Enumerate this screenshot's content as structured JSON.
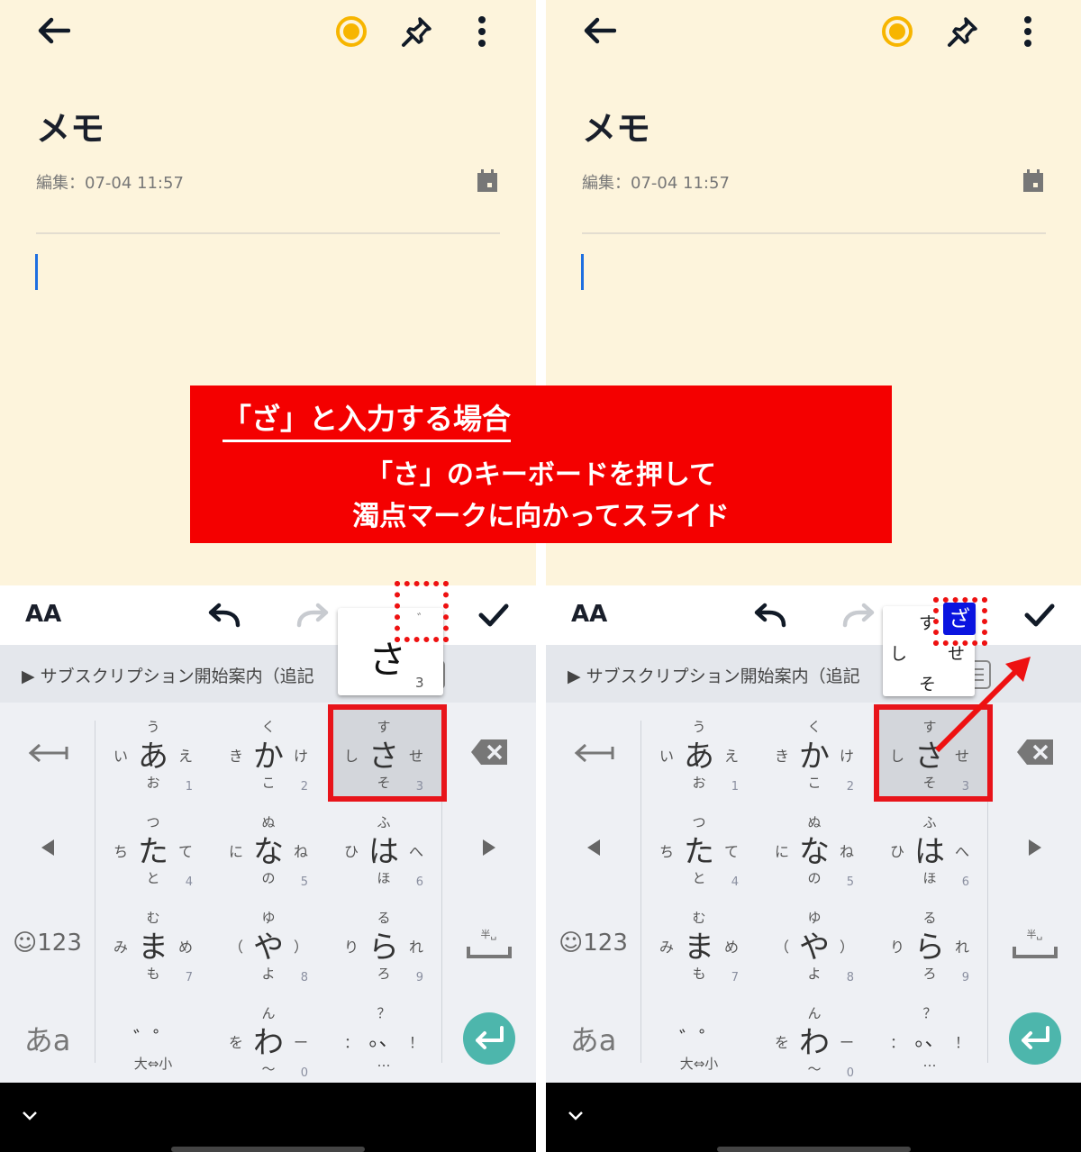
{
  "note": {
    "title": "メモ",
    "edited": "編集：07-04 11:57"
  },
  "toolbar": {
    "text_style": "AA"
  },
  "suggestion": {
    "text": "▶ サブスクリプション開始案内（追記"
  },
  "keyboard": {
    "keys": [
      {
        "m": "あ",
        "l": "い",
        "t": "う",
        "r": "え",
        "b": "お",
        "n": "1"
      },
      {
        "m": "か",
        "l": "き",
        "t": "く",
        "r": "け",
        "b": "こ",
        "n": "2"
      },
      {
        "m": "さ",
        "l": "し",
        "t": "す",
        "r": "せ",
        "b": "そ",
        "n": "3"
      },
      {
        "m": "た",
        "l": "ち",
        "t": "つ",
        "r": "て",
        "b": "と",
        "n": "4"
      },
      {
        "m": "な",
        "l": "に",
        "t": "ぬ",
        "r": "ね",
        "b": "の",
        "n": "5"
      },
      {
        "m": "は",
        "l": "ひ",
        "t": "ふ",
        "r": "へ",
        "b": "ほ",
        "n": "6"
      },
      {
        "m": "ま",
        "l": "み",
        "t": "む",
        "r": "め",
        "b": "も",
        "n": "7"
      },
      {
        "m": "や",
        "l": "（",
        "t": "ゆ",
        "r": "）",
        "b": "よ",
        "n": "8"
      },
      {
        "m": "ら",
        "l": "り",
        "t": "る",
        "r": "れ",
        "b": "ろ",
        "n": "9"
      },
      {
        "m": "゛゜",
        "l": "",
        "t": "",
        "r": "",
        "b": "大⇔小",
        "n": ""
      },
      {
        "m": "わ",
        "l": "を",
        "t": "ん",
        "r": "ー",
        "b": "〜",
        "n": "0"
      },
      {
        "m": "。、",
        "l": "：",
        "t": "？",
        "r": "！",
        "b": "…",
        "n": ""
      }
    ],
    "emoji_num": "☺123",
    "kana_mode": "あa",
    "space_label": "半␣",
    "accent": "#4db6ac"
  },
  "popups": {
    "left": {
      "main": "さ",
      "dakuten": "゛",
      "num": "3"
    },
    "right": {
      "top": "す",
      "selected": "ざ",
      "left": "し",
      "right": "せ",
      "bottom": "そ",
      "selected_color": "#0a14e0"
    }
  },
  "banner": {
    "heading": "「ざ」と入力する場合",
    "line1": "「さ」のキーボードを押して",
    "line2": "濁点マークに向かってスライド",
    "color": "#f40000"
  }
}
